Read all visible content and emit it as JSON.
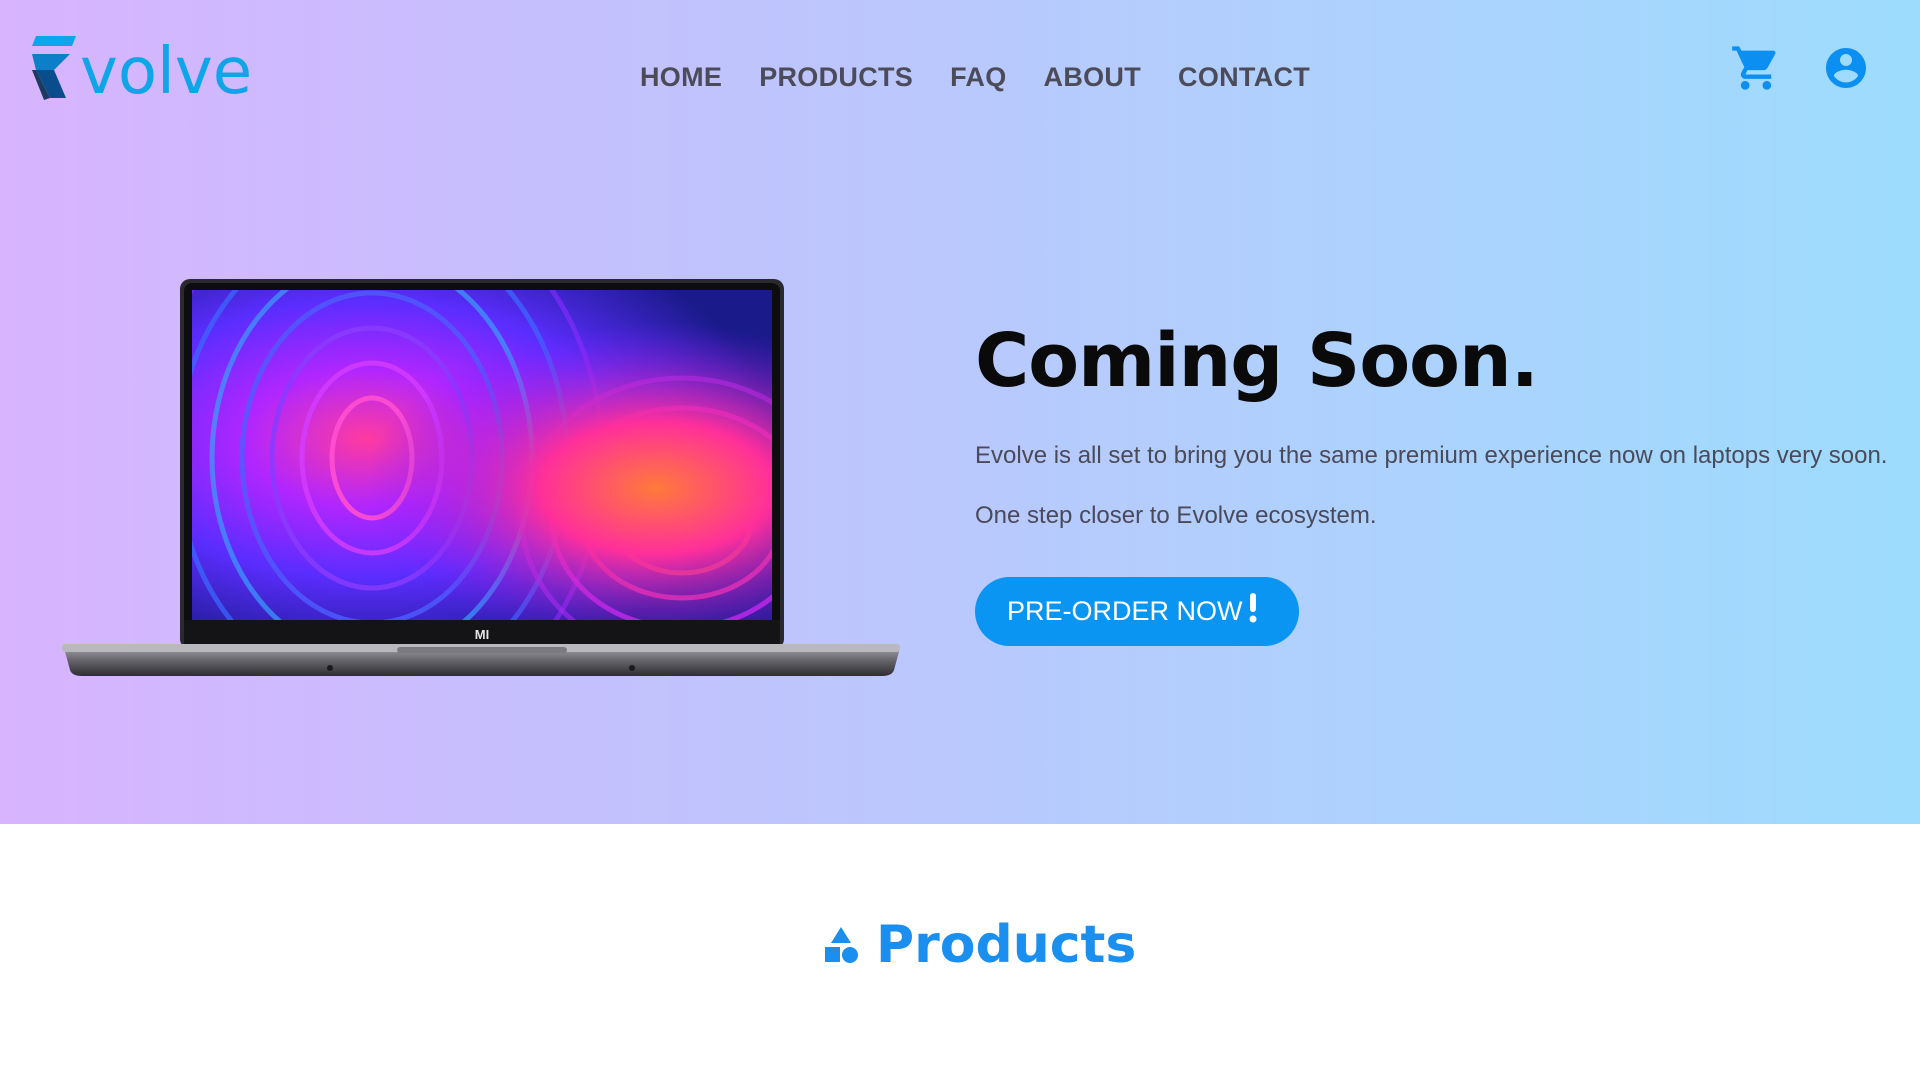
{
  "brand": {
    "name": "volve",
    "color": "#0ea5e9"
  },
  "nav": {
    "items": [
      "HOME",
      "PRODUCTS",
      "FAQ",
      "ABOUT",
      "CONTACT"
    ]
  },
  "header_icons": [
    "cart-icon",
    "account-icon"
  ],
  "hero": {
    "title": "Coming Soon.",
    "description": "Evolve is all set to bring you the same premium experience now on laptops very soon.",
    "subtitle": "One step closer to Evolve ecosystem.",
    "cta_label": "PRE-ORDER NOW",
    "cta_color": "#0b95f2",
    "laptop_logo": "MI"
  },
  "products": {
    "title": "Products",
    "icon": "shapes-icon",
    "color": "#1a8ff0"
  }
}
